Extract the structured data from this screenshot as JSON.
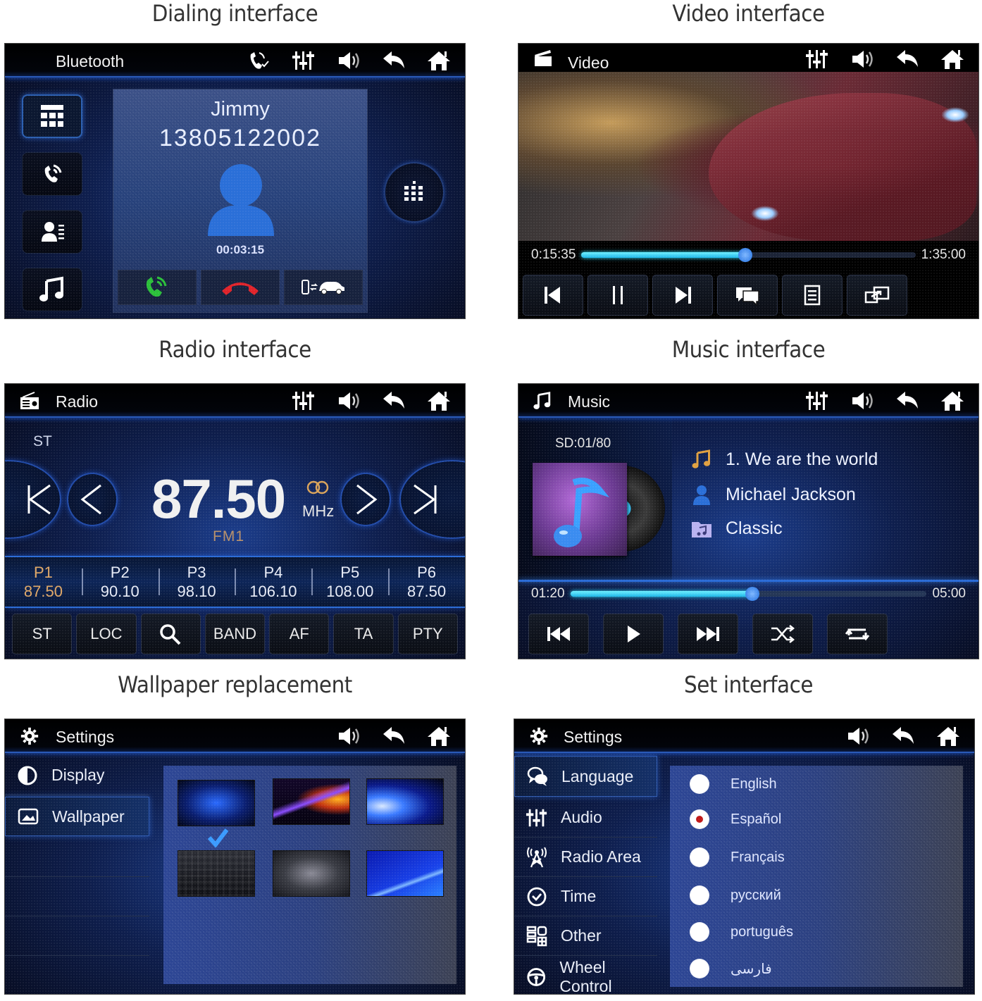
{
  "sections": {
    "dialing": {
      "caption": "Dialing interface",
      "header_title": "Bluetooth",
      "header_icons": [
        "phone-link-icon",
        "equalizer-icon",
        "volume-icon",
        "back-icon",
        "home-icon"
      ],
      "side_buttons": [
        {
          "name": "dialpad-icon",
          "active": true
        },
        {
          "name": "call-log-icon",
          "active": false
        },
        {
          "name": "contacts-icon",
          "active": false
        },
        {
          "name": "bt-music-icon",
          "active": false
        }
      ],
      "contact_name": "Jimmy",
      "contact_number": "13805122002",
      "call_duration": "00:03:15",
      "actions": [
        "answer-call",
        "hang-up",
        "transfer-to-phone"
      ],
      "colors": {
        "answer": "#2bbf3a",
        "hangup": "#e0232a"
      }
    },
    "video": {
      "caption": "Video interface",
      "header_title": "Video",
      "header_icons": [
        "equalizer-icon",
        "volume-icon",
        "back-icon",
        "home-icon"
      ],
      "elapsed": "0:15:35",
      "total": "1:35:00",
      "progress_fraction": 0.49,
      "controls": [
        "previous",
        "pause",
        "next",
        "subtitles",
        "playlist",
        "screen-output"
      ]
    },
    "radio": {
      "caption": "Radio interface",
      "header_title": "Radio",
      "header_icons": [
        "equalizer-icon",
        "volume-icon",
        "back-icon",
        "home-icon"
      ],
      "stereo_label": "ST",
      "frequency": "87.50",
      "unit": "MHz",
      "band": "FM1",
      "presets": [
        {
          "label": "P1",
          "freq": "87.50",
          "active": true
        },
        {
          "label": "P2",
          "freq": "90.10",
          "active": false
        },
        {
          "label": "P3",
          "freq": "98.10",
          "active": false
        },
        {
          "label": "P4",
          "freq": "106.10",
          "active": false
        },
        {
          "label": "P5",
          "freq": "108.00",
          "active": false
        },
        {
          "label": "P6",
          "freq": "87.50",
          "active": false
        }
      ],
      "buttons": [
        "ST",
        "LOC",
        "",
        "BAND",
        "AF",
        "TA",
        "PTY"
      ],
      "colors": {
        "active_preset": "#e0a868"
      }
    },
    "music": {
      "caption": "Music interface",
      "header_title": "Music",
      "header_icons": [
        "equalizer-icon",
        "volume-icon",
        "back-icon",
        "home-icon"
      ],
      "source_counter": "SD:01/80",
      "track": "1.  We are the world",
      "artist": "Michael Jackson",
      "album": "Classic",
      "elapsed": "01:20",
      "total": "05:00",
      "progress_fraction": 0.51,
      "controls": [
        "previous",
        "play",
        "next",
        "shuffle",
        "repeat"
      ]
    },
    "wallpaper": {
      "caption": "Wallpaper replacement",
      "header_title": "Settings",
      "header_icons": [
        "volume-icon",
        "back-icon",
        "home-icon"
      ],
      "menu": [
        {
          "label": "Display",
          "icon": "contrast-icon",
          "active": false
        },
        {
          "label": "Wallpaper",
          "icon": "image-icon",
          "active": true
        }
      ],
      "thumbnails": [
        {
          "name": "blue-glow",
          "selected": true
        },
        {
          "name": "color-waves",
          "selected": false
        },
        {
          "name": "blue-light",
          "selected": false
        },
        {
          "name": "dark-grid",
          "selected": false
        },
        {
          "name": "gray-spot",
          "selected": false
        },
        {
          "name": "blue-curve",
          "selected": false
        }
      ]
    },
    "settings": {
      "caption": "Set interface",
      "header_title": "Settings",
      "header_icons": [
        "volume-icon",
        "back-icon",
        "home-icon"
      ],
      "menu": [
        {
          "label": "Language",
          "icon": "chat-bubbles-icon",
          "active": true
        },
        {
          "label": "Audio",
          "icon": "equalizer-icon",
          "active": false
        },
        {
          "label": "Radio Area",
          "icon": "antenna-icon",
          "active": false
        },
        {
          "label": "Time",
          "icon": "clock-icon",
          "active": false
        },
        {
          "label": "Other",
          "icon": "grid-icon",
          "active": false
        },
        {
          "label": "Wheel Control",
          "icon": "steering-wheel-icon",
          "active": false
        }
      ],
      "languages": [
        {
          "label": "English",
          "selected": false
        },
        {
          "label": "Español",
          "selected": true
        },
        {
          "label": "Français",
          "selected": false
        },
        {
          "label": "русский",
          "selected": false
        },
        {
          "label": "português",
          "selected": false
        },
        {
          "label": "فارسی",
          "selected": false
        }
      ]
    }
  }
}
